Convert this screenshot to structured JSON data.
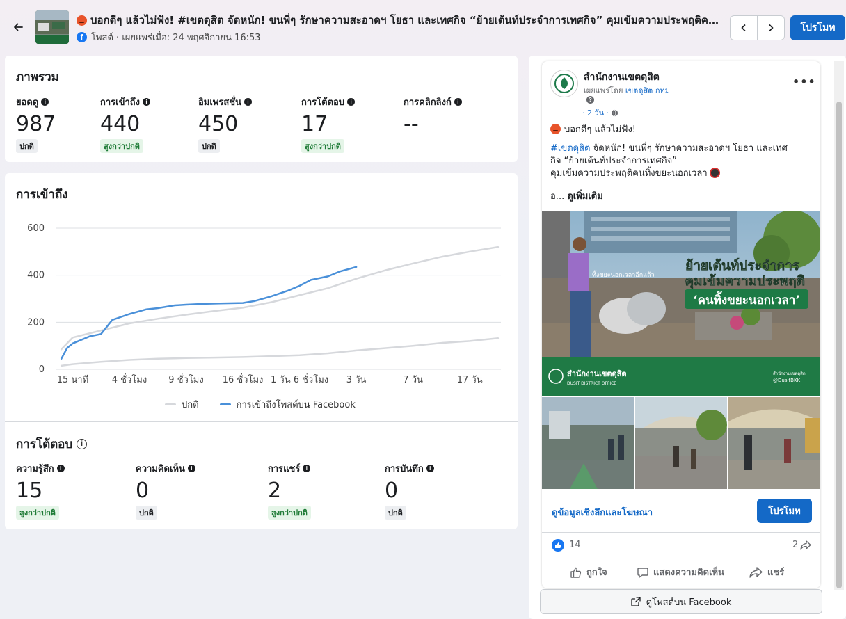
{
  "header": {
    "title": "บอกดีๆ แล้วไม่ฟัง! #เขตดุสิต จัดหนัก! ขนพี่ๆ รักษาความสะอาดฯ โยธา และเทศกิจ “ย้ายเต้นท์ประจำการเทศกิจ” คุมเข้มความประพฤติคนทิ้งขยะนอกเวลา",
    "subtitle": "โพสต์ · เผยแพร่เมื่อ: 24 พฤศจิกายน 16:53",
    "fb_letter": "f",
    "promote_label": "โปรโมท"
  },
  "overview": {
    "title": "ภาพรวม",
    "metrics": [
      {
        "label": "ยอดดู",
        "value": "987",
        "badge": "ปกติ",
        "badge_type": "normal"
      },
      {
        "label": "การเข้าถึง",
        "value": "440",
        "badge": "สูงกว่าปกติ",
        "badge_type": "high"
      },
      {
        "label": "อิมเพรสชั่น",
        "value": "450",
        "badge": "ปกติ",
        "badge_type": "normal"
      },
      {
        "label": "การโต้ตอบ",
        "value": "17",
        "badge": "สูงกว่าปกติ",
        "badge_type": "high"
      },
      {
        "label": "การคลิกลิงก์",
        "value": "--",
        "badge": "",
        "badge_type": "none"
      }
    ]
  },
  "reach": {
    "title": "การเข้าถึง",
    "legend": [
      {
        "name": "ปกติ",
        "color": "#d6d8dc"
      },
      {
        "name": "การเข้าถึงโพสต์บน Facebook",
        "color": "#4a90d9"
      }
    ]
  },
  "chart_data": {
    "type": "line",
    "title": "การเข้าถึง",
    "xlabel": "",
    "ylabel": "",
    "ylim": [
      0,
      600
    ],
    "yticks": [
      "0",
      "200",
      "400",
      "600"
    ],
    "x_tick_labels": [
      "15 นาที",
      "4 ชั่วโมง",
      "9 ชั่วโมง",
      "16 ชั่วโมง",
      "1 วัน 6 ชั่วโมง",
      "3 วัน",
      "7 วัน",
      "17 วัน"
    ],
    "x_tick_positions": [
      0,
      1,
      2,
      3,
      4,
      5,
      6,
      7
    ],
    "xlim": [
      -0.3,
      7.55
    ],
    "legend_position": "bottom",
    "grid": true,
    "series": [
      {
        "name": "ปกติ",
        "color": "#d6d8dc",
        "x": [
          -0.2,
          0,
          0.5,
          1,
          1.5,
          2,
          2.5,
          3,
          3.5,
          4,
          4.5,
          5,
          5.5,
          6,
          6.5,
          7,
          7.5
        ],
        "y": [
          85,
          135,
          165,
          195,
          215,
          232,
          248,
          262,
          285,
          315,
          345,
          385,
          420,
          450,
          478,
          500,
          520
        ]
      },
      {
        "name": "ปกติ",
        "color": "#d6d8dc",
        "x": [
          -0.2,
          0,
          0.5,
          1,
          1.5,
          2,
          2.5,
          3,
          3.5,
          4,
          4.5,
          5,
          5.5,
          6,
          6.5,
          7,
          7.5
        ],
        "y": [
          15,
          22,
          32,
          40,
          45,
          48,
          50,
          52,
          56,
          60,
          68,
          80,
          90,
          100,
          112,
          120,
          132
        ]
      },
      {
        "name": "การเข้าถึงโพสต์บน Facebook",
        "color": "#4a90d9",
        "x": [
          -0.2,
          -0.1,
          0,
          0.3,
          0.5,
          0.7,
          1,
          1.3,
          1.5,
          1.8,
          2,
          2.3,
          2.6,
          3,
          3.2,
          3.5,
          3.8,
          4,
          4.2,
          4.5,
          4.7,
          5
        ],
        "y": [
          45,
          90,
          110,
          140,
          150,
          210,
          235,
          255,
          260,
          272,
          275,
          278,
          280,
          282,
          290,
          310,
          335,
          355,
          380,
          395,
          415,
          435
        ]
      }
    ]
  },
  "interactions": {
    "title": "การโต้ตอบ",
    "metrics": [
      {
        "label": "ความรู้สึก",
        "value": "15",
        "badge": "สูงกว่าปกติ",
        "badge_type": "high"
      },
      {
        "label": "ความคิดเห็น",
        "value": "0",
        "badge": "ปกติ",
        "badge_type": "normal"
      },
      {
        "label": "การแชร์",
        "value": "2",
        "badge": "สูงกว่าปกติ",
        "badge_type": "high"
      },
      {
        "label": "การบันทึก",
        "value": "0",
        "badge": "ปกติ",
        "badge_type": "normal"
      }
    ]
  },
  "post": {
    "page_name": "สำนักงานเขตดุสิต",
    "published_by_prefix": "เผยแพร่โดย",
    "published_by_link": "เขตดุสิต กทม",
    "time": "· 2 วัน ·",
    "text_line1": "บอกดีๆ แล้วไม่ฟัง!",
    "hashtag": "#เขตดุสิต",
    "text_line2": " จัดหนัก! ขนพี่ๆ รักษาความสะอาดฯ โยธา และเทศ",
    "text_line3": "กิจ “ย้ายเต้นท์ประจำการเทศกิจ”",
    "text_line4": "คุมเข้มความประพฤติคนทิ้งขยะนอกเวลา",
    "see_more_prefix": "อ... ",
    "see_more": "ดูเพิ่มเติม",
    "image_text_small": "ทิ้งขยะนอกเวลาอีกแล้ว",
    "image_text_1": "ย้ายเต้นท์ประจำการ",
    "image_text_2": "คุมเข้มความประพฤติ",
    "image_text_3": "‘คนทิ้งขยะนอกเวลา’",
    "image_footer_name": "สำนักงานเขตดุสิต",
    "image_footer_en": "DUSIT DISTRICT OFFICE",
    "image_footer_handle1": "สำนักงานเขตดุสิต",
    "image_footer_handle2": "@DusitBKK",
    "insights_link": "ดูข้อมูลเชิงลึกและโฆษณา",
    "promote_label": "โปรโมท",
    "like_count": "14",
    "share_count": "2",
    "action_like": "ถูกใจ",
    "action_comment": "แสดงความคิดเห็น",
    "action_share": "แชร์",
    "view_on_fb": "ดูโพสต์บน Facebook"
  }
}
